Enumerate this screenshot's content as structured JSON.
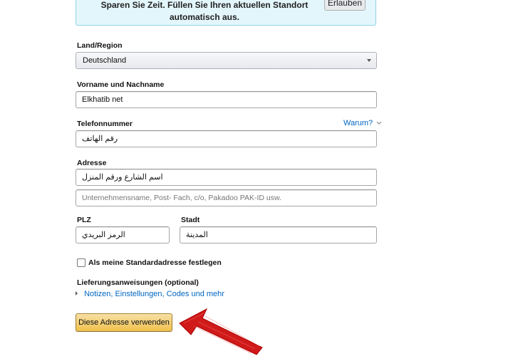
{
  "banner": {
    "text_line1": "Sparen Sie Zeit. Füllen Sie Ihren aktuellen Standort",
    "text_line2": "automatisch aus.",
    "allow_button": "Erlauben"
  },
  "country": {
    "label": "Land/Region",
    "selected": "Deutschland"
  },
  "full_name": {
    "label": "Vorname und Nachname",
    "value": "Elkhatib net"
  },
  "phone": {
    "label": "Telefonnummer",
    "why_link": "Warum?",
    "value": "رقم الهاتف"
  },
  "address": {
    "label": "Adresse",
    "line1_value": "اسم الشارع ورقم المنزل",
    "line2_placeholder": "Unternehmensname, Post- Fach, c/o, Pakadoo PAK-ID usw."
  },
  "postal_code": {
    "label": "PLZ",
    "value": "الرمز البريدي"
  },
  "city": {
    "label": "Stadt",
    "value": "المدينة"
  },
  "default_address": {
    "label": "Als meine Standardadresse festlegen",
    "checked": false
  },
  "delivery_instructions": {
    "label": "Lieferungsanweisungen (optional)",
    "expander": "Notizen, Einstellungen, Codes und mehr"
  },
  "submit": {
    "label": "Diese Adresse verwenden"
  },
  "colors": {
    "link": "#0066c0",
    "primary_button": "#f0c14b",
    "banner_bg": "#e3f6fb",
    "annotation_arrow": "#d01a1a"
  },
  "icons": [
    "chevron-down-icon",
    "caret-right-icon",
    "red-arrow-annotation"
  ]
}
